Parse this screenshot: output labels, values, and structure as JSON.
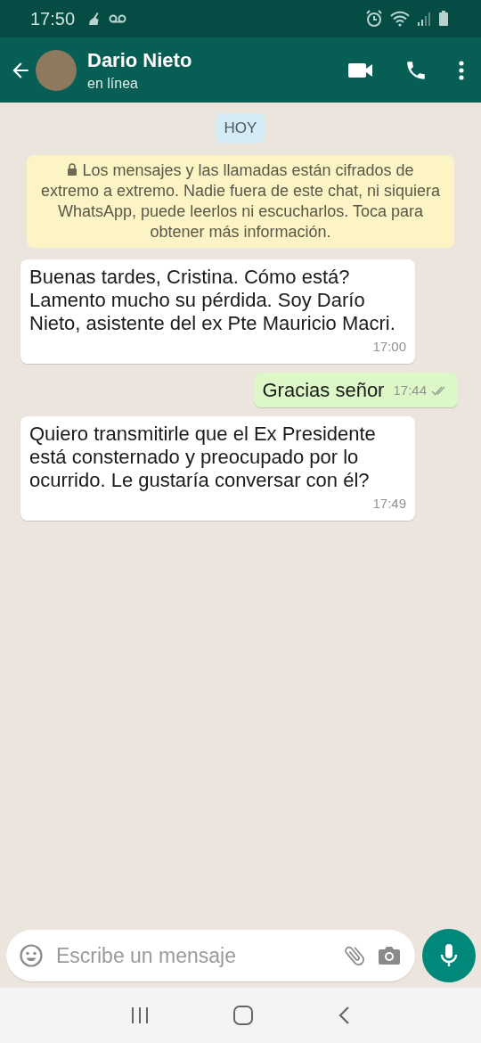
{
  "status_bar": {
    "time": "17:50"
  },
  "header": {
    "name": "Dario Nieto",
    "presence": "en línea"
  },
  "date_chip": "HOY",
  "encryption_notice": "Los mensajes y las llamadas están cifrados de extremo a extremo. Nadie fuera de este chat, ni siquiera WhatsApp, puede leerlos ni escucharlos. Toca para obtener más información.",
  "messages": [
    {
      "kind": "incoming",
      "text": "Buenas tardes, Cristina. Cómo está? Lamento mucho su pérdida. Soy Darío Nieto, asistente del ex Pte Mauricio Macri.",
      "time": "17:00"
    },
    {
      "kind": "outgoing",
      "text": "Gracias señor",
      "time": "17:44",
      "read": false
    },
    {
      "kind": "incoming",
      "text": "Quiero transmitirle que el Ex Presidente está consternado y preocupado por lo ocurrido. Le gustaría conversar con él?",
      "time": "17:49"
    }
  ],
  "composer": {
    "placeholder": "Escribe un mensaje"
  }
}
